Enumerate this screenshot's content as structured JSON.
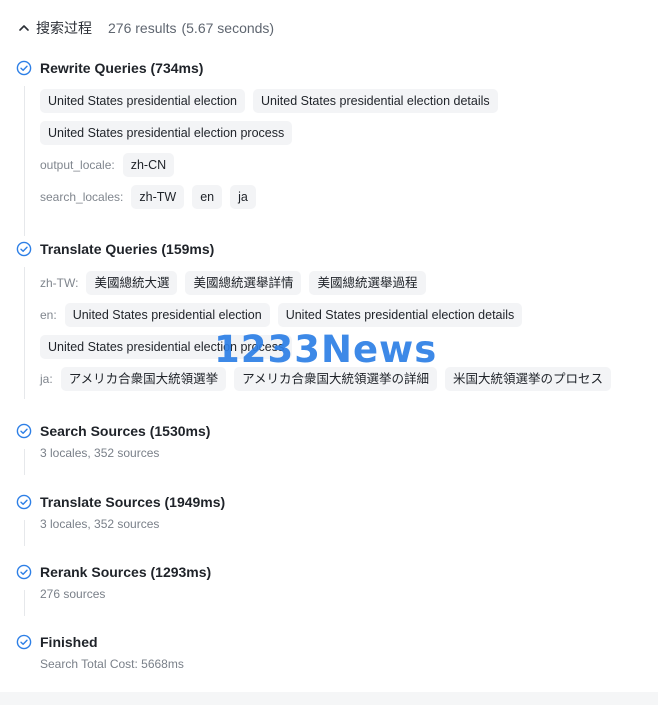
{
  "header": {
    "title": "搜索过程",
    "results": "276 results",
    "time": "(5.67 seconds)"
  },
  "steps": {
    "rewrite": {
      "title": "Rewrite Queries (734ms)",
      "queries": [
        "United States presidential election",
        "United States presidential election details",
        "United States presidential election process"
      ],
      "output_locale_label": "output_locale:",
      "output_locale": "zh-CN",
      "search_locales_label": "search_locales:",
      "search_locales": [
        "zh-TW",
        "en",
        "ja"
      ]
    },
    "translate": {
      "title": "Translate Queries (159ms)",
      "zh_label": "zh-TW:",
      "zh": [
        "美國總統大選",
        "美國總統選舉詳情",
        "美國總統選舉過程"
      ],
      "en_label": "en:",
      "en": [
        "United States presidential election",
        "United States presidential election details",
        "United States presidential election process"
      ],
      "ja_label": "ja:",
      "ja": [
        "アメリカ合衆国大統領選挙",
        "アメリカ合衆国大統領選挙の詳細",
        "米国大統領選挙のプロセス"
      ]
    },
    "search": {
      "title": "Search Sources (1530ms)",
      "sub": "3 locales, 352 sources"
    },
    "translate_sources": {
      "title": "Translate Sources (1949ms)",
      "sub": "3 locales, 352 sources"
    },
    "rerank": {
      "title": "Rerank Sources (1293ms)",
      "sub": "276 sources"
    },
    "finished": {
      "title": "Finished",
      "sub": "Search Total Cost: 5668ms"
    }
  },
  "watermark": "1233News",
  "colors": {
    "accent": "#2d7fe6",
    "chip_bg": "#f3f4f6",
    "muted": "#7a8089"
  },
  "icons": {
    "collapse": "chevron-up-icon",
    "status": "check-circle-icon"
  }
}
